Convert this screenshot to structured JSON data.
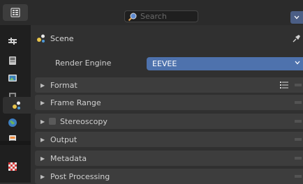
{
  "header": {
    "editor_type_icon": "properties-editor-icon",
    "search": {
      "placeholder": "Search"
    },
    "menu_icon": "chevron-down-icon"
  },
  "tabs": [
    {
      "name": "tool",
      "icon": "tool-icon"
    },
    {
      "name": "render",
      "icon": "render-icon"
    },
    {
      "name": "output",
      "icon": "output-icon"
    },
    {
      "name": "view-layer",
      "icon": "view-layer-icon"
    },
    {
      "name": "scene",
      "icon": "scene-icon",
      "active": true
    },
    {
      "name": "world",
      "icon": "world-icon"
    },
    {
      "name": "collection",
      "icon": "collection-icon"
    },
    {
      "name": "texture",
      "icon": "texture-icon"
    }
  ],
  "context": {
    "title": "Scene",
    "icon": "scene-icon",
    "pin_icon": "pin-icon"
  },
  "render_engine": {
    "label": "Render Engine",
    "value": "EEVEE"
  },
  "sections": [
    {
      "label": "Format"
    },
    {
      "label": "Frame Range"
    },
    {
      "label": "Stereoscopy"
    },
    {
      "label": "Output"
    },
    {
      "label": "Metadata"
    },
    {
      "label": "Post Processing"
    }
  ],
  "colors": {
    "accent": "#4e72ad",
    "panel": "#303030",
    "section": "#3d3d3d"
  }
}
